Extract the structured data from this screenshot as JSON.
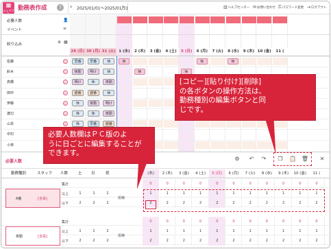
{
  "header": {
    "logo_label": "シェアプル",
    "title": "勤務表作成",
    "date_range": "2025/01/01〜2025/01/31",
    "help_center": "ヘルプセンター",
    "contact": "お問い合わせ",
    "password": "パスワード変更",
    "logout": "ログアウト"
  },
  "upper": {
    "required_label": "必要人数",
    "event_label": "イベント",
    "filter_label": "絞り込み",
    "days": [
      "29 (日)",
      "30 (月)",
      "31 (火)",
      "1 (水)",
      "2 (木)",
      "3 (金)",
      "4 (土)",
      "5 (日)",
      "6 (月)",
      "7 (火)",
      "8 (水)",
      "9 (木)",
      "10 (金)",
      "11 ("
    ],
    "staff": [
      "佐藤",
      "鈴木",
      "高橋",
      "田中",
      "伊藤",
      "渡辺",
      "山本",
      "中村",
      "小林"
    ],
    "prev_month_shifts": [
      [
        "早番",
        "早番",
        "休"
      ],
      [
        "夜勤",
        "明け",
        "休"
      ],
      [
        "明け",
        "休",
        "夜勤"
      ],
      [
        "遅番",
        "遅番",
        "休"
      ],
      [
        "休",
        "夜勤",
        "明け"
      ],
      [
        "休",
        "休",
        "夜勤"
      ],
      [
        "休",
        "早番",
        "遅番"
      ],
      [
        "",
        "",
        ""
      ],
      [
        "",
        "",
        ""
      ]
    ],
    "kyuu_label": "休",
    "shift_colors": {
      "早番": "#cfe3f3",
      "夜勤": "#ecd0ec",
      "明け": "#ecd0ec",
      "遅番": "#f4dccb",
      "休": "#dde8f6"
    }
  },
  "callouts": {
    "copy": [
      "[コピー][貼り付け][削除]",
      "の各ボタンの操作方法は、",
      "勤務種別の編集ボタンと同",
      "じです。"
    ],
    "pc": [
      "必要人数欄はＰＣ版のよ",
      "うに日ごとに編集することが",
      "できます。"
    ]
  },
  "lower": {
    "title": "必要人数",
    "col_type": "勤務種別",
    "col_staff": "スタッフ",
    "col_count": "人数",
    "wd_sat": "土",
    "wd_sun": "日",
    "wd_hol": "祝",
    "reflect": "反映",
    "day_heads": [
      "(木)",
      "2 (木)",
      "3 (金)",
      "4 (土)",
      "5 (日)",
      "6 (月)",
      "7 (火)",
      "8 (水)",
      "9 (木)",
      "10 (金)",
      "11 ("
    ],
    "sum": "集計",
    "upper": "以上",
    "lower": "以下",
    "type1": "A番",
    "type2": "夜勤",
    "staff_link": "[全員]",
    "sum_vals": [
      "0",
      "0",
      "0",
      "0",
      "0",
      "0",
      "0",
      "0",
      "0",
      "0",
      "0"
    ],
    "row_upper_vals": [
      "1",
      "1",
      "1",
      "1",
      "1",
      "1",
      "1",
      "1",
      "1",
      "1",
      "1"
    ],
    "row_lower_vals": [
      "2",
      "2",
      "2",
      "2",
      "2",
      "2",
      "2",
      "2",
      "2",
      "2",
      "2"
    ],
    "wd_vals_upper": [
      "1",
      "1",
      "2"
    ],
    "wd_vals_lower": [
      "2",
      "2",
      "2"
    ]
  }
}
